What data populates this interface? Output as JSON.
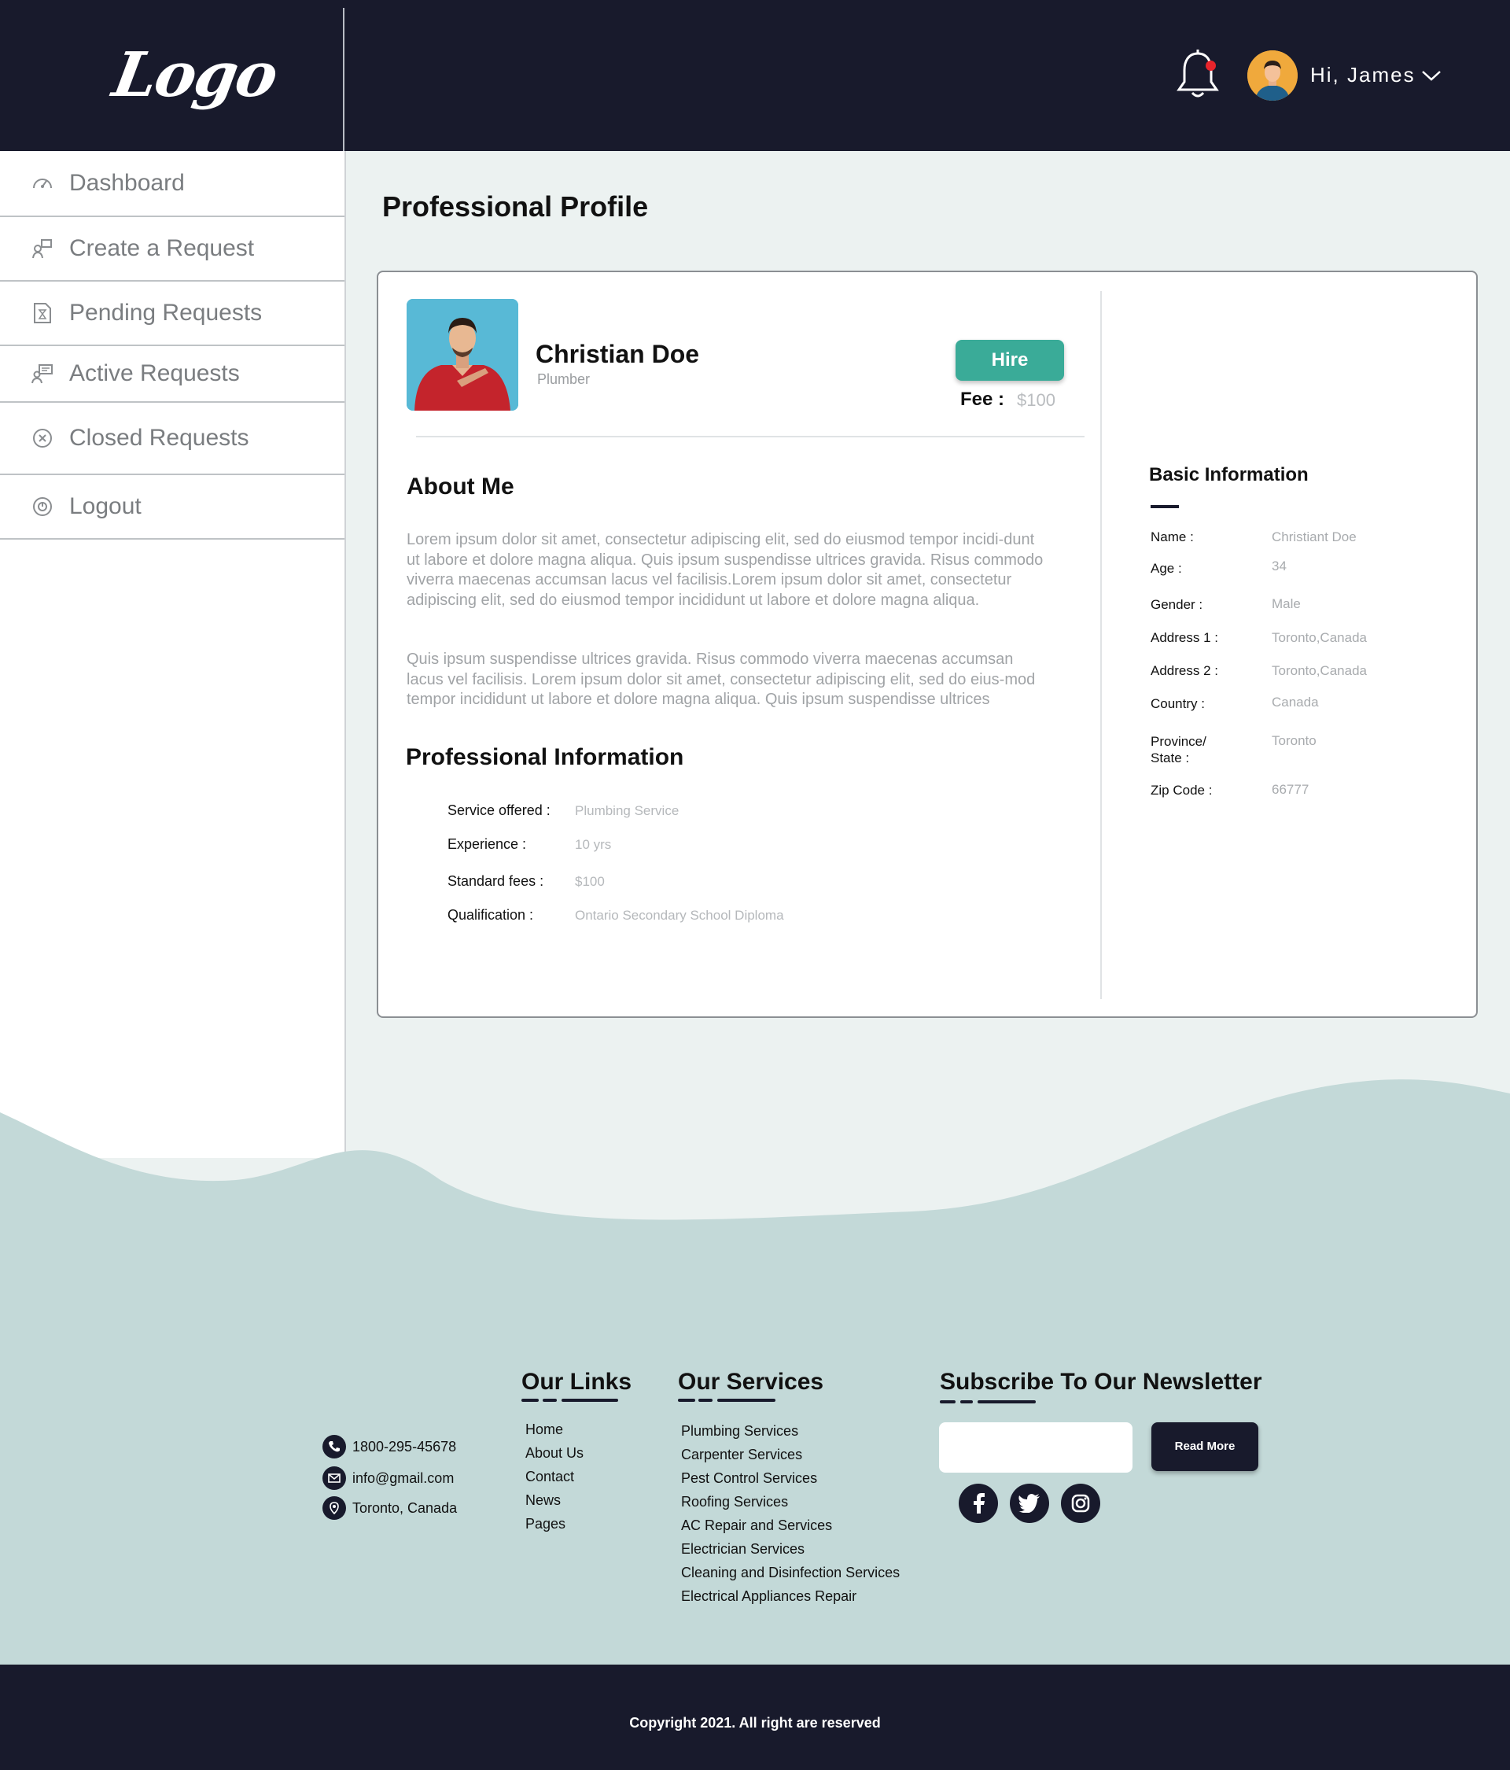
{
  "header": {
    "logo_text": "Logo",
    "greeting": "Hi, James"
  },
  "sidebar": {
    "items": [
      {
        "label": "Dashboard",
        "icon": "speedometer-icon"
      },
      {
        "label": "Create a Request",
        "icon": "create-request-icon"
      },
      {
        "label": "Pending Requests",
        "icon": "hourglass-doc-icon"
      },
      {
        "label": "Active Requests",
        "icon": "chat-user-icon"
      },
      {
        "label": "Closed Requests",
        "icon": "close-circle-icon"
      },
      {
        "label": "Logout",
        "icon": "logout-icon"
      }
    ]
  },
  "main": {
    "page_title": "Professional Profile",
    "profile": {
      "name": "Christian Doe",
      "role": "Plumber",
      "hire_label": "Hire",
      "fee_label": "Fee :",
      "fee_value": "$100"
    },
    "about": {
      "heading": "About Me",
      "paragraph1": "Lorem ipsum dolor sit amet, consectetur adipiscing elit, sed do eiusmod tempor incidi-dunt ut labore et dolore magna aliqua. Quis ipsum suspendisse ultrices gravida. Risus commodo viverra maecenas accumsan lacus vel facilisis.Lorem ipsum dolor sit amet, consectetur adipiscing elit, sed do eiusmod tempor incididunt ut labore et dolore magna aliqua.",
      "paragraph2": "Quis ipsum suspendisse ultrices gravida. Risus commodo viverra maecenas accumsan lacus vel facilisis. Lorem ipsum dolor sit amet, consectetur adipiscing elit, sed do eius-mod tempor incididunt ut labore et dolore magna aliqua. Quis ipsum suspendisse ultrices"
    },
    "professional_info": {
      "heading": "Professional Information",
      "rows": [
        {
          "label": "Service offered :",
          "value": "Plumbing Service"
        },
        {
          "label": "Experience :",
          "value": "10 yrs"
        },
        {
          "label": "Standard fees :",
          "value": "$100"
        },
        {
          "label": "Qualification :",
          "value": "Ontario Secondary School Diploma"
        }
      ]
    },
    "basic_info": {
      "heading": "Basic Information",
      "rows": [
        {
          "label": "Name :",
          "value": "Christiant Doe"
        },
        {
          "label": "Age :",
          "value": "34"
        },
        {
          "label": "Gender :",
          "value": "Male"
        },
        {
          "label": "Address 1 :",
          "value": "Toronto,Canada"
        },
        {
          "label": "Address 2 :",
          "value": "Toronto,Canada"
        },
        {
          "label": "Country :",
          "value": "Canada"
        },
        {
          "label": "Province/\nState :",
          "value": "Toronto"
        },
        {
          "label": "Zip Code :",
          "value": "66777"
        }
      ]
    }
  },
  "footer": {
    "contact": [
      {
        "icon": "phone-icon",
        "text": "1800-295-45678"
      },
      {
        "icon": "mail-icon",
        "text": "info@gmail.com"
      },
      {
        "icon": "location-icon",
        "text": "Toronto, Canada"
      }
    ],
    "links_heading": "Our Links",
    "links": [
      "Home",
      "About Us",
      "Contact",
      "News",
      "Pages"
    ],
    "services_heading": "Our Services",
    "services": [
      "Plumbing Services",
      "Carpenter Services",
      "Pest Control Services",
      "Roofing Services",
      "AC Repair and Services",
      "Electrician Services",
      "Cleaning and Disinfection Services",
      "Electrical Appliances Repair"
    ],
    "newsletter_heading": "Subscribe To Our Newsletter",
    "newsletter_button": "Read More",
    "social": [
      "facebook-icon",
      "twitter-icon",
      "instagram-icon"
    ],
    "copyright": "Copyright 2021. All right are reserved"
  },
  "colors": {
    "navy": "#181a2c",
    "accent": "#3aab98",
    "footer_bg": "#c3d9d8",
    "page_bg": "#ecf2f1"
  }
}
